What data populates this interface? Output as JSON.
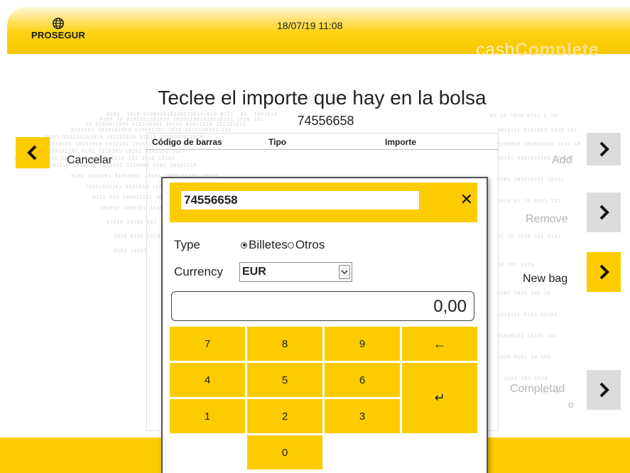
{
  "header": {
    "brand": "PROSEGUR",
    "datetime": "18/07/19 11:08",
    "product_light": "cash",
    "product_bold": "Complete"
  },
  "page": {
    "title": "Teclee el importe que hay en la bolsa",
    "bag_number": "74556658"
  },
  "table": {
    "columns": [
      "Código de barras",
      "Tipo",
      "Importe"
    ]
  },
  "nav": {
    "cancel": "Cancelar",
    "add": "Add",
    "remove": "Remove",
    "new_bag": "New bag",
    "complete_line1": "Completad",
    "complete_line2": "o"
  },
  "modal": {
    "barcode_value": "74556658",
    "close_symbol": "✕",
    "type_label": "Type",
    "type_options": [
      "Billetes",
      "Otros"
    ],
    "type_selected": "Billetes",
    "currency_label": "Currency",
    "currency_value": "EUR",
    "amount": "0,00",
    "keys": {
      "k7": "7",
      "k8": "8",
      "k9": "9",
      "backspace": "←",
      "k4": "4",
      "k5": "5",
      "k6": "6",
      "enter": "↵",
      "k1": "1",
      "k2": "2",
      "k3": "3",
      "k0": "0"
    }
  },
  "colors": {
    "accent": "#fccc00",
    "disabled": "#dcdcdc"
  }
}
